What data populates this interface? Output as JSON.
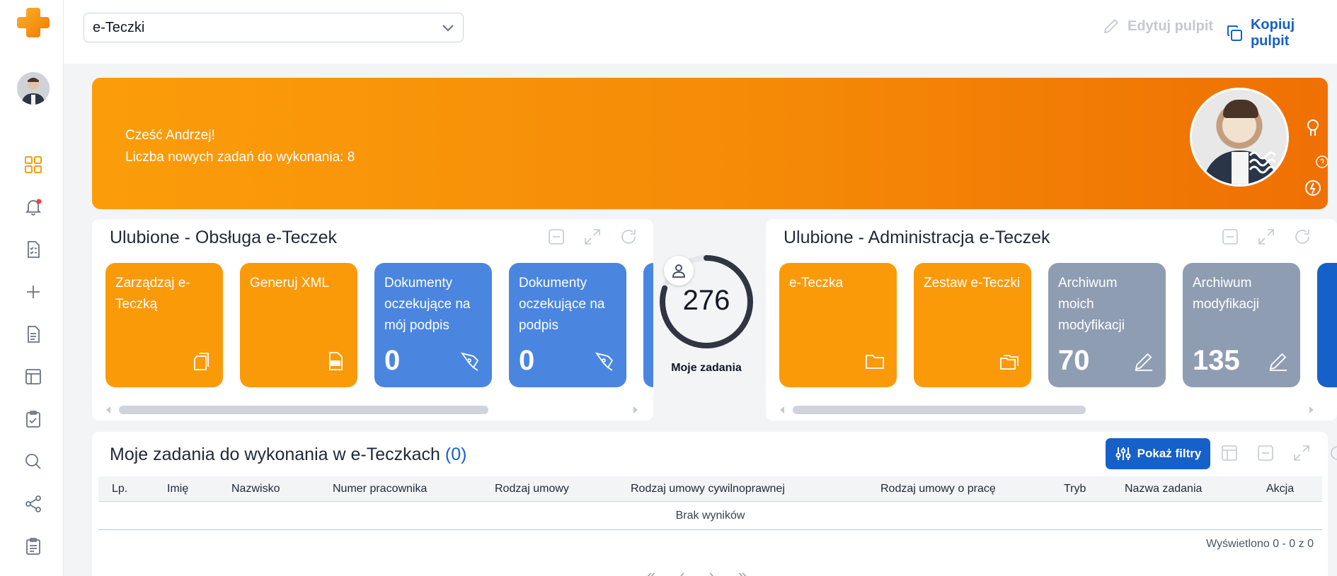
{
  "header": {
    "dashboard_select": "e-Teczki",
    "edit_label": "Edytuj pulpit",
    "copy_label": "Kopiuj pulpit"
  },
  "banner": {
    "greeting": "Cześć Andrzej!",
    "tasks_line": "Liczba nowych zadań do wykonania: 8"
  },
  "panels": {
    "left": {
      "title": "Ulubione - Obsługa e-Teczek",
      "tiles": [
        {
          "label": "Zarządzaj e-Teczką",
          "color": "orange",
          "icon": "document-stack-icon"
        },
        {
          "label": "Generuj XML",
          "color": "orange",
          "icon": "xml-file-icon"
        },
        {
          "label": "Dokumenty oczekujące na mój podpis",
          "value": "0",
          "color": "blue",
          "icon": "signature-pen-icon"
        },
        {
          "label": "Dokumenty oczekujące na podpis",
          "value": "0",
          "color": "blue",
          "icon": "signature-pen-icon"
        }
      ]
    },
    "right": {
      "title": "Ulubione - Administracja e-Teczek",
      "tiles": [
        {
          "label": "e-Teczka",
          "color": "orange",
          "icon": "folder-icon"
        },
        {
          "label": "Zestaw e-Teczki",
          "color": "orange",
          "icon": "folders-icon"
        },
        {
          "label": "Archiwum moich modyfikacji",
          "value": "70",
          "color": "grey",
          "icon": "pencil-icon"
        },
        {
          "label": "Archiwum modyfikacji",
          "value": "135",
          "color": "grey",
          "icon": "pencil-icon"
        }
      ]
    }
  },
  "tasks_widget": {
    "count": "276",
    "label": "Moje zadania",
    "progress": 0.8
  },
  "tasks_table": {
    "title": "Moje zadania do wykonania w e-Teczkach",
    "count": "(0)",
    "filters_label": "Pokaż filtry",
    "columns": [
      "Lp.",
      "Imię",
      "Nazwisko",
      "Numer pracownika",
      "Rodzaj umowy",
      "Rodzaj umowy cywilnoprawnej",
      "Rodzaj umowy o pracę",
      "Tryb",
      "Nazwa zadania",
      "Akcja"
    ],
    "empty_text": "Brak wyników",
    "shown_text": "Wyświetlono 0 - 0 z 0"
  },
  "colors": {
    "orange": "#fb9a09",
    "blue": "#4a86e0",
    "grey": "#8f9db3",
    "primary": "#1660c9"
  }
}
